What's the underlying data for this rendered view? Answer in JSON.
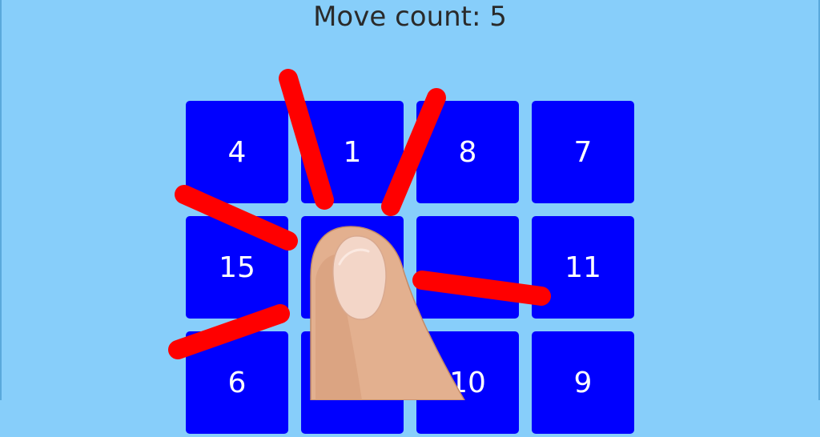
{
  "header": {
    "move_count": "Move count: 5"
  },
  "board": {
    "rows": [
      [
        {
          "label": "4"
        },
        {
          "label": "1"
        },
        {
          "label": "8"
        },
        {
          "label": "7"
        }
      ],
      [
        {
          "label": "15"
        },
        {
          "label": ""
        },
        {
          "label": ""
        },
        {
          "label": "11"
        }
      ],
      [
        {
          "label": "6"
        },
        {
          "label": ""
        },
        {
          "label": "10"
        },
        {
          "label": "9"
        }
      ]
    ],
    "tile_color": "#0000ff",
    "background_color": "#87cefa"
  },
  "overlay": {
    "tap_burst_color": "#ff0000",
    "hand_icon": "pointing-finger-icon"
  }
}
